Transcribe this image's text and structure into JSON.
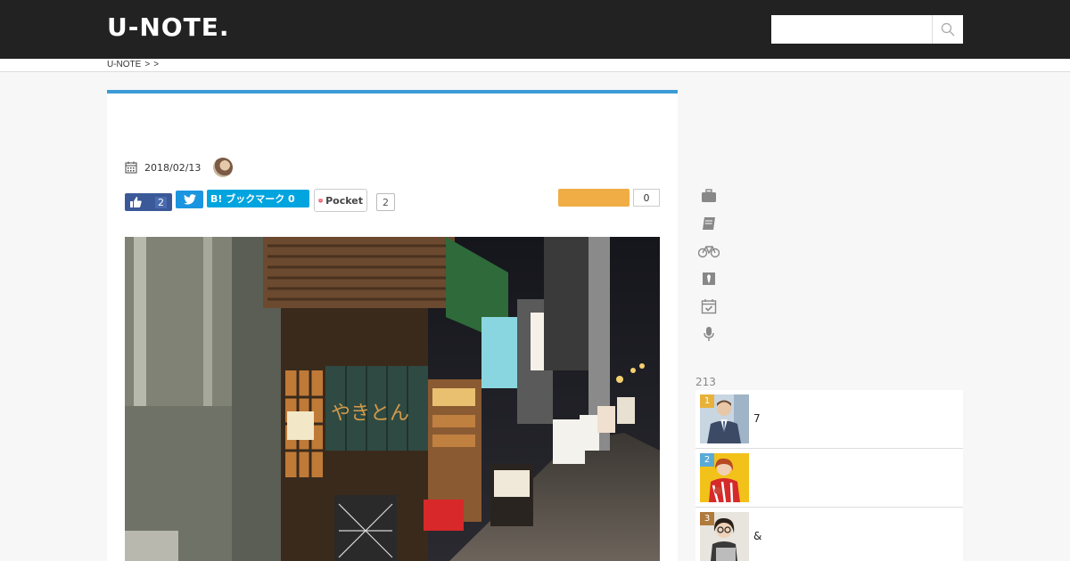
{
  "header": {
    "logo": "U-NOTE.",
    "search_placeholder": ""
  },
  "breadcrumb": {
    "home": "U-NOTE",
    "sep1": ">",
    "sep2": ">"
  },
  "article": {
    "date": "2018/02/13",
    "social": {
      "fb_count": "2",
      "hatena_label": "B! ブックマーク 0",
      "pocket_label": "Pocket",
      "pocket_count": "2",
      "orange_count": "0"
    }
  },
  "sidebar": {
    "category_icons": [
      "briefcase-icon",
      "book-icon",
      "bicycle-icon",
      "tie-icon",
      "calendar-check-icon",
      "microphone-icon"
    ],
    "ranking_title": "213",
    "ranking": [
      {
        "rank": "1",
        "text": "7",
        "color": "#e8b23a"
      },
      {
        "rank": "2",
        "text": "",
        "color": "#5aaad6"
      },
      {
        "rank": "3",
        "text": "&",
        "color": "#b07a3c"
      }
    ]
  },
  "colors": {
    "header_bg": "#222222",
    "accent_blue": "#3b9bd6",
    "facebook": "#3b5998",
    "twitter": "#1b95e0",
    "hatena": "#00a4de",
    "pocket_red": "#ef4056",
    "orange": "#f0ad45"
  }
}
